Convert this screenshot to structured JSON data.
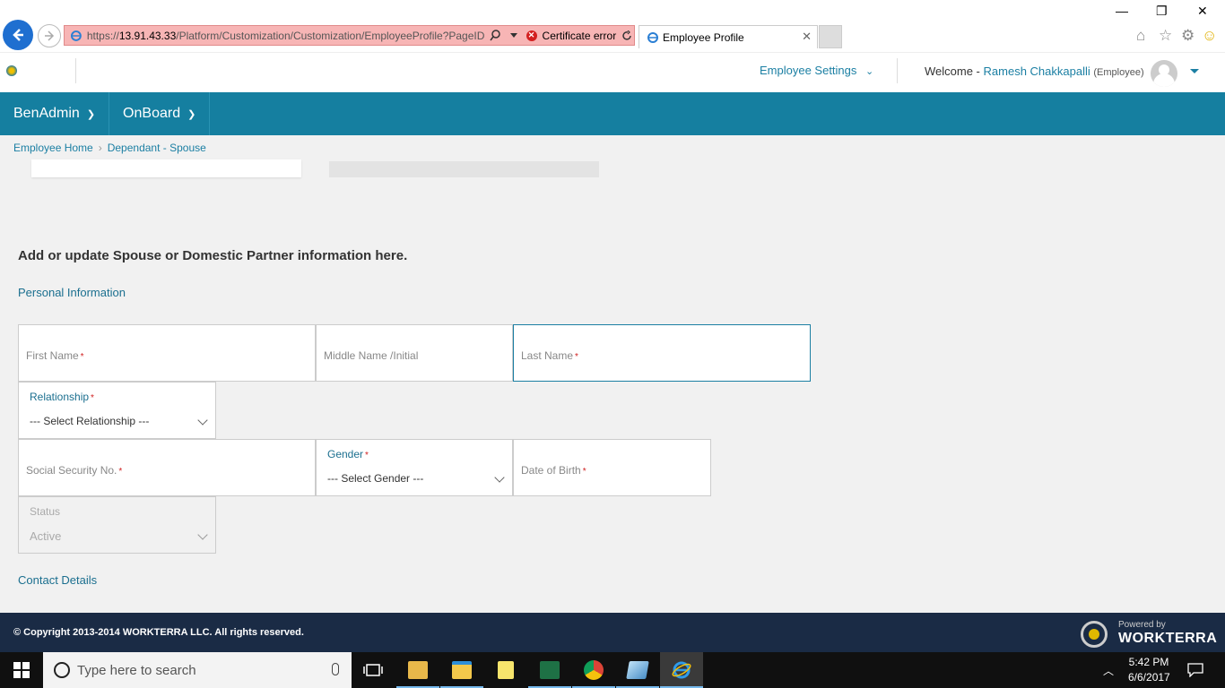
{
  "browser": {
    "url_prefix": "https://",
    "url_host": "13.91.43.33",
    "url_path": "/Platform/Customization/Customization/EmployeeProfile?PageID=",
    "cert_error": "Certificate error",
    "tab_title": "Employee Profile"
  },
  "header": {
    "settings_label": "Employee Settings",
    "welcome_label": "Welcome -",
    "user_name": "Ramesh Chakkapalli",
    "user_role": "(Employee)"
  },
  "nav": {
    "items": [
      {
        "label": "BenAdmin"
      },
      {
        "label": "OnBoard"
      }
    ]
  },
  "breadcrumb": {
    "home": "Employee Home",
    "current": "Dependant - Spouse"
  },
  "form": {
    "headline": "Add or update Spouse or Domestic Partner information here.",
    "personal_section": "Personal Information",
    "contact_section": "Contact Details",
    "first_name_placeholder": "First Name",
    "middle_name_placeholder": "Middle Name /Initial",
    "last_name_placeholder": "Last Name",
    "relationship_label": "Relationship",
    "relationship_value": "--- Select Relationship ---",
    "ssn_placeholder": "Social Security No.",
    "gender_label": "Gender",
    "gender_value": "--- Select Gender ---",
    "dob_placeholder": "Date of Birth",
    "status_label": "Status",
    "status_value": "Active",
    "required_mark": "*"
  },
  "footer": {
    "copyright": "© Copyright 2013-2014 WORKTERRA LLC. All rights reserved.",
    "powered_by": "Powered by",
    "brand": "WORKTERRA"
  },
  "taskbar": {
    "search_placeholder": "Type here to search",
    "time": "5:42 PM",
    "date": "6/6/2017"
  },
  "colors": {
    "nav_bg": "#157fa0",
    "accent": "#1b7fa3",
    "footer_bg": "#1a2b45",
    "address_error_bg": "#f7b5b5"
  }
}
